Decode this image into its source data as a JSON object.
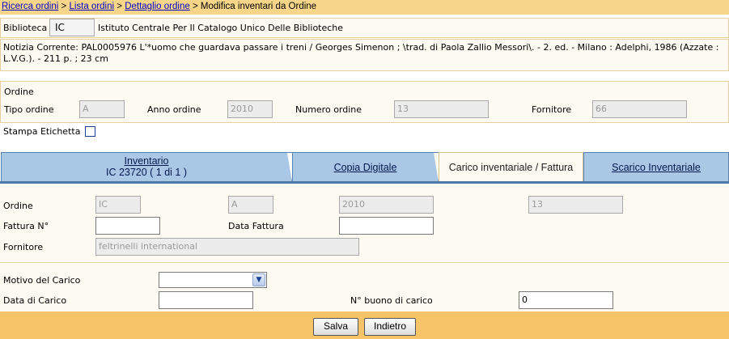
{
  "breadcrumb": {
    "items": [
      "Ricerca ordini",
      "Lista ordini",
      "Dettaglio ordine"
    ],
    "separator": ">",
    "current": "Modifica inventari da Ordine"
  },
  "biblioteca": {
    "label": "Biblioteca",
    "code": "IC",
    "name": "Istituto Centrale Per Il Catalogo Unico Delle Biblioteche"
  },
  "notizia": {
    "text": "Notizia Corrente: PAL0005976  L'*uomo che guardava passare i treni / Georges Simenon ; \\trad. di Paola Zallio Messori\\. - 2. ed. - Milano : Adelphi, 1986 (Azzate : L.V.G.). - 211 p. ; 23 cm"
  },
  "ordine": {
    "title": "Ordine",
    "tipo_label": "Tipo ordine",
    "tipo_value": "A",
    "anno_label": "Anno ordine",
    "anno_value": "2010",
    "numero_label": "Numero ordine",
    "numero_value": "13",
    "fornitore_label": "Fornitore",
    "fornitore_value": "66",
    "stampa_label": "Stampa Etichetta"
  },
  "tabs": [
    {
      "label": "Inventario",
      "sub": "IC 23720 ( 1 di 1 )"
    },
    {
      "label": "Copia Digitale"
    },
    {
      "label": "Carico inventariale / Fattura"
    },
    {
      "label": "Scarico Inventariale"
    }
  ],
  "carico": {
    "ordine_label": "Ordine",
    "ordine_values": [
      "IC",
      "A",
      "2010",
      "13"
    ],
    "fattura_label": "Fattura N°",
    "fattura_value": "",
    "data_fattura_label": "Data Fattura",
    "data_fattura_value": "",
    "fornitore_label": "Fornitore",
    "fornitore_value": "feltrinelli international",
    "motivo_label": "Motivo del Carico",
    "motivo_value": "",
    "data_carico_label": "Data di Carico",
    "data_carico_value": "",
    "buono_label": "N° buono di carico",
    "buono_value": "0"
  },
  "buttons": {
    "save": "Salva",
    "back": "Indietro"
  },
  "colors": {
    "header_bg": "#f7d589",
    "footer_bg": "#f7c46a",
    "tab_bg": "#a9c8e6",
    "link": "#0000cc"
  }
}
